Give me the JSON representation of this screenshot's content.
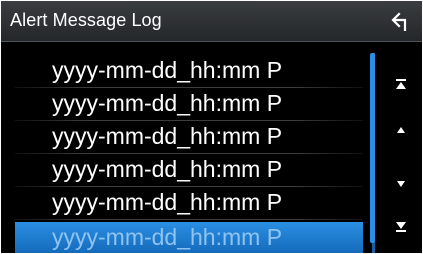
{
  "header": {
    "title": "Alert Message Log",
    "back_icon": "back-arrow-icon"
  },
  "list": {
    "items": [
      {
        "label": "yyyy-mm-dd_hh:mm P",
        "selected": false
      },
      {
        "label": "yyyy-mm-dd_hh:mm P",
        "selected": false
      },
      {
        "label": "yyyy-mm-dd_hh:mm P",
        "selected": false
      },
      {
        "label": "yyyy-mm-dd_hh:mm P",
        "selected": false
      },
      {
        "label": "yyyy-mm-dd_hh:mm P",
        "selected": false
      },
      {
        "label": "yyyy-mm-dd_hh:mm P",
        "selected": true
      }
    ]
  },
  "scroll": {
    "buttons": [
      "scroll-to-top-icon",
      "scroll-up-icon",
      "scroll-down-icon",
      "scroll-to-bottom-icon"
    ]
  },
  "colors": {
    "background": "#000000",
    "header": "#2f3235",
    "accent": "#2d8ee6",
    "text": "#ffffff"
  }
}
